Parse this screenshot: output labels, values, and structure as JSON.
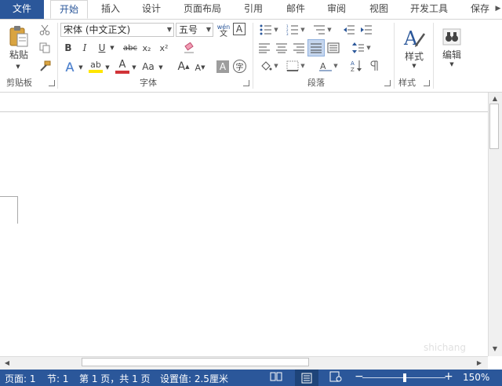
{
  "tabs": {
    "file": "文件",
    "home": "开始",
    "insert": "插入",
    "design": "设计",
    "layout": "页面布局",
    "references": "引用",
    "mailings": "邮件",
    "review": "审阅",
    "view": "视图",
    "developer": "开发工具",
    "save": "保存"
  },
  "clipboard": {
    "paste_label": "粘贴",
    "group_label": "剪贴板"
  },
  "font": {
    "name": "宋体 (中文正文)",
    "size": "五号",
    "phonetic_top": "wén",
    "phonetic_bottom": "文",
    "bold": "B",
    "italic": "I",
    "underline": "U",
    "strike": "abc",
    "subscript": "x₂",
    "superscript": "x²",
    "text_effect": "A",
    "highlight": "ab",
    "color": "A",
    "change_case": "Aa",
    "grow": "A",
    "shrink": "A",
    "char_shading": "A",
    "enclose": "字",
    "border": "A",
    "group_label": "字体",
    "accent_red": "#d13438",
    "highlight_yellow": "#ffe600"
  },
  "paragraph": {
    "group_label": "段落"
  },
  "styles": {
    "label": "样式",
    "group_label": "样式"
  },
  "editing": {
    "label": "编辑"
  },
  "statusbar": {
    "page": "页面: 1",
    "section": "节: 1",
    "page_count": "第 1 页，共 1 页",
    "setting": "设置值: 2.5厘米",
    "zoom": "150%",
    "zoom_level_percent": 150
  },
  "watermark": "shichang",
  "colors": {
    "accent": "#2b579a",
    "selected": "#c5d6ee"
  }
}
